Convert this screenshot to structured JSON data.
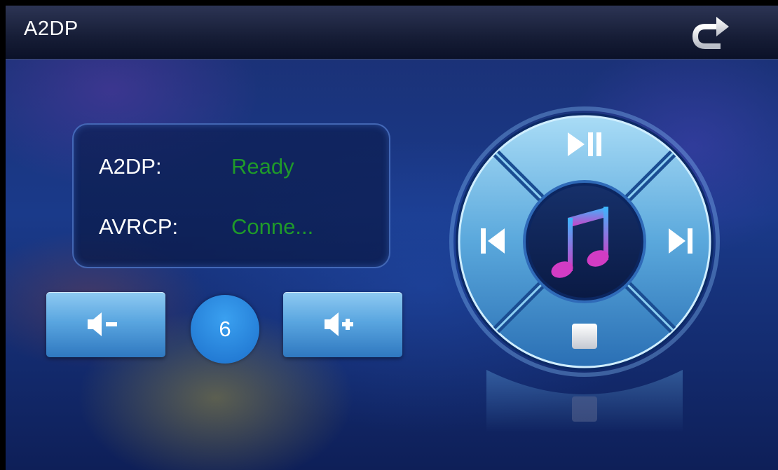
{
  "header": {
    "title": "A2DP"
  },
  "status": {
    "rows": [
      {
        "label": "A2DP:",
        "value": "Ready"
      },
      {
        "label": "AVRCP:",
        "value": "Conne..."
      }
    ],
    "value_color": "#1f9a2a"
  },
  "volume": {
    "level": "6"
  },
  "icons": {
    "back": "back-arrow-icon",
    "volume_down": "volume-down-icon",
    "volume_up": "volume-up-icon",
    "play_pause": "play-pause-icon",
    "previous": "skip-previous-icon",
    "next": "skip-next-icon",
    "stop": "stop-icon",
    "center": "music-note-icon"
  },
  "colors": {
    "accent": "#3aa0f0",
    "button_top": "#8fcaf2",
    "button_bottom": "#2f78c0",
    "background": "#1a3a8a"
  }
}
